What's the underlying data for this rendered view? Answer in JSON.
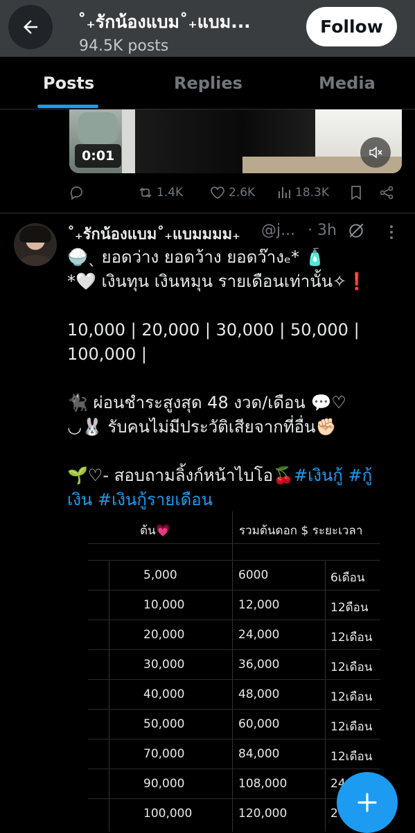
{
  "header": {
    "title": "˚₊รักน้องแบม˚₊แบม...",
    "subtitle": "94.5K posts",
    "follow_label": "Follow"
  },
  "tabs": [
    {
      "label": "Posts",
      "active": true
    },
    {
      "label": "Replies",
      "active": false
    },
    {
      "label": "Media",
      "active": false
    }
  ],
  "video": {
    "timestamp": "0:01"
  },
  "prev_actions": {
    "reposts": "1.4K",
    "likes": "2.6K",
    "views": "18.3K"
  },
  "post": {
    "name": "˚₊รักน้องแบม˚₊แบมมมม₊",
    "handle": "@j...",
    "time": "· 3h",
    "lines": [
      "🍚ˎ ยอดว่าง ยอดว้าง ยอดว๊างₑ* 🧴",
      "*🤍 เงินทุน เงินหมุน รายเดือนเท่านั้น✧❗",
      "",
      "10,000 | 20,000 | 30,000 |  50,000 |",
      "100,000 |",
      "",
      "🐈‍⬛ ผ่อนชำระสูงสุด 48 งวด/เดือน 💬♡",
      "◡🐰 รับคนไม่มีประวัติเสียจากที่อื่น✊🏻",
      "",
      "🌱♡- สอบถามลิ้งก์หน้าไบโอ🍒"
    ],
    "hashtags_line1": "#เงินกู้ #กู้",
    "hashtags_line2_prefix": "เงิน",
    "hashtags_line2": "#เงินกู้รายเดือน"
  },
  "sheet": {
    "headers": [
      "ต้น💗",
      "รวมต้นดอก $ ระยะเวลา"
    ],
    "rows": [
      [
        "5,000",
        "6000",
        "6เดือน"
      ],
      [
        "10,000",
        "12,000",
        "12ดือน"
      ],
      [
        "20,000",
        "24,000",
        "12เดือน"
      ],
      [
        "30,000",
        "36,000",
        "12เดือน"
      ],
      [
        "40,000",
        "48,000",
        "12เดือน"
      ],
      [
        "50,000",
        "60,000",
        "12เดือน"
      ],
      [
        "70,000",
        "84,000",
        "12เดือน"
      ],
      [
        "90,000",
        "108,000",
        "24"
      ],
      [
        "100,000",
        "120,000",
        "2"
      ]
    ]
  },
  "colors": {
    "accent": "#1d9bf0",
    "background": "#000000",
    "muted": "#71767b"
  }
}
